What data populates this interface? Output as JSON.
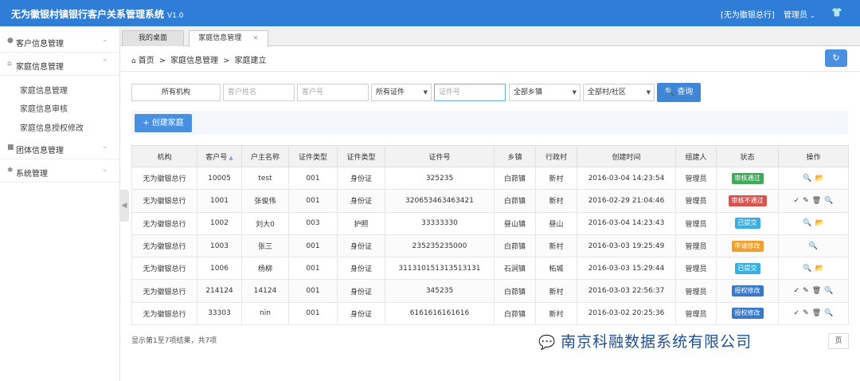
{
  "header": {
    "title": "无为徽银村镇银行客户关系管理系统",
    "version": "V1.0",
    "org": "[无为徽银总行]",
    "user": "管理员",
    "user_caret": "⌄",
    "shirt_icon": "👕"
  },
  "sidebar": {
    "items": [
      {
        "label": "客户信息管理",
        "icon": "user-icon",
        "chevron": "⌄"
      },
      {
        "label": "家庭信息管理",
        "icon": "home-icon",
        "chevron": "⌃"
      },
      {
        "label": "团体信息管理",
        "icon": "group-icon",
        "chevron": "⌄"
      },
      {
        "label": "系统管理",
        "icon": "gear-icon",
        "chevron": "⌄"
      }
    ],
    "sub_items": [
      "家庭信息管理",
      "家庭信息审核",
      "家庭信息授权修改"
    ],
    "collapse_glyph": "◀"
  },
  "tabs": [
    {
      "label": "我的桌面"
    },
    {
      "label": "家庭信息管理",
      "close": "×"
    }
  ],
  "breadcrumb": {
    "home_glyph": "⌂",
    "items": [
      "首页",
      ">",
      "家庭信息管理",
      ">",
      "家庭建立"
    ],
    "refresh_glyph": "↻"
  },
  "filters": {
    "org_button": "所有机构",
    "customer_name_placeholder": "客户姓名",
    "customer_id_placeholder": "客户号",
    "id_type_select": "所有证件",
    "id_number_placeholder": "证件号",
    "town_select": "全部乡镇",
    "village_select": "全部村/社区",
    "dropdown_glyph": "▼",
    "search_icon": "🔍",
    "search_label": "查询"
  },
  "create_button": "+ 创建家庭",
  "table": {
    "headers": [
      "机构",
      "客户号",
      "户主名称",
      "证件类型",
      "证件类型",
      "证件号",
      "乡镇",
      "行政村",
      "创建时间",
      "组建人",
      "状态",
      "操作"
    ],
    "sort_glyph": "▲",
    "rows": [
      {
        "org": "无为徽银总行",
        "cid": "10005",
        "name": "test",
        "code": "001",
        "idtype": "身份证",
        "idno": "325235",
        "town": "白茆镇",
        "village": "新村",
        "time": "2016-03-04 14:23:54",
        "creator": "管理员",
        "status": "审核通过",
        "status_color": "#3eaa5a",
        "ops": [
          "🔍",
          "📂"
        ]
      },
      {
        "org": "无为徽银总行",
        "cid": "1001",
        "name": "张俊伟",
        "code": "001",
        "idtype": "身份证",
        "idno": "320653463463421",
        "town": "白茆镇",
        "village": "新村",
        "time": "2016-02-29 21:04:46",
        "creator": "管理员",
        "status": "审核不通过",
        "status_color": "#d9534f",
        "ops": [
          "✓",
          "✎",
          "🗑",
          "🔍"
        ]
      },
      {
        "org": "无为徽银总行",
        "cid": "1002",
        "name": "刘大0",
        "code": "003",
        "idtype": "护照",
        "idno": "33333330",
        "town": "昼山镇",
        "village": "昼山",
        "time": "2016-03-04 14:23:43",
        "creator": "管理员",
        "status": "已提交",
        "status_color": "#3ab0e0",
        "ops": [
          "🔍",
          "📂"
        ]
      },
      {
        "org": "无为徽银总行",
        "cid": "1003",
        "name": "张三",
        "code": "001",
        "idtype": "身份证",
        "idno": "235235235000",
        "town": "白茆镇",
        "village": "新村",
        "time": "2016-03-03 19:25:49",
        "creator": "管理员",
        "status": "申请修改",
        "status_color": "#f0a030",
        "ops": [
          "🔍"
        ]
      },
      {
        "org": "无为徽银总行",
        "cid": "1006",
        "name": "杨柳",
        "code": "001",
        "idtype": "身份证",
        "idno": "311310151313513131",
        "town": "石涧镇",
        "village": "柘城",
        "time": "2016-03-03 15:29:44",
        "creator": "管理员",
        "status": "已提交",
        "status_color": "#3ab0e0",
        "ops": [
          "🔍",
          "📂"
        ]
      },
      {
        "org": "无为徽银总行",
        "cid": "214124",
        "name": "14124",
        "code": "001",
        "idtype": "身份证",
        "idno": "345235",
        "town": "白茆镇",
        "village": "新村",
        "time": "2016-03-03 22:56:37",
        "creator": "管理员",
        "status": "授权修改",
        "status_color": "#3a78c8",
        "ops": [
          "✓",
          "✎",
          "🗑",
          "🔍"
        ]
      },
      {
        "org": "无为徽银总行",
        "cid": "33303",
        "name": "nin",
        "code": "001",
        "idtype": "身份证",
        "idno": "6161616161616",
        "town": "白茆镇",
        "village": "新村",
        "time": "2016-03-02 20:25:36",
        "creator": "管理员",
        "status": "授权修改",
        "status_color": "#3a78c8",
        "ops": [
          "✓",
          "✎",
          "🗑",
          "🔍"
        ]
      }
    ]
  },
  "footer": {
    "info": "显示第1至7项结果，共7项",
    "pager": "页",
    "watermark": "南京科融数据系统有限公司",
    "watermark_icon": "💬"
  }
}
